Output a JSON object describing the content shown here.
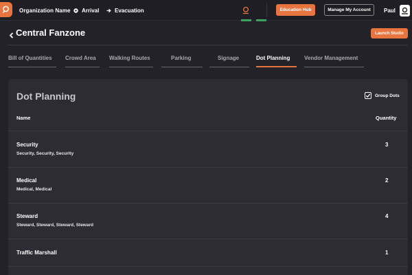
{
  "topbar": {
    "org_name": "Organization Name",
    "nav": [
      {
        "label": "Arrival",
        "icon": "circle-dot-icon"
      },
      {
        "label": "Evacuation",
        "icon": "arrow-right-icon"
      }
    ],
    "education_hub_label": "Education Hub",
    "manage_account_label": "Manage My Account",
    "user_name": "Paul"
  },
  "page": {
    "title": "Central Fanzone",
    "launch_studio_label": "Launch Studio"
  },
  "tabs": [
    {
      "label": "Bill of Quantities",
      "active": false
    },
    {
      "label": "Crowd Area",
      "active": false
    },
    {
      "label": "Walking Routes",
      "active": false
    },
    {
      "label": "Parking",
      "active": false
    },
    {
      "label": "Signage",
      "active": false
    },
    {
      "label": "Dot Planning",
      "active": true
    },
    {
      "label": "Vendor Management",
      "active": false
    }
  ],
  "panel": {
    "title": "Dot Planning",
    "group_dots_label": "Group Dots",
    "group_dots_checked": true,
    "columns": {
      "name": "Name",
      "quantity": "Quantity"
    },
    "rows": [
      {
        "name": "Security",
        "detail": "Security, Security, Security",
        "quantity": "3"
      },
      {
        "name": "Medical",
        "detail": "Medical, Medical",
        "quantity": "2"
      },
      {
        "name": "Steward",
        "detail": "Steward, Steward, Steward, Steward",
        "quantity": "4"
      },
      {
        "name": "Traffic Marshall",
        "detail": "",
        "quantity": "1"
      }
    ]
  },
  "colors": {
    "accent": "#e8743f",
    "background": "#232229",
    "panel": "#2d2c35",
    "indicator_green": "#3aa35c"
  }
}
